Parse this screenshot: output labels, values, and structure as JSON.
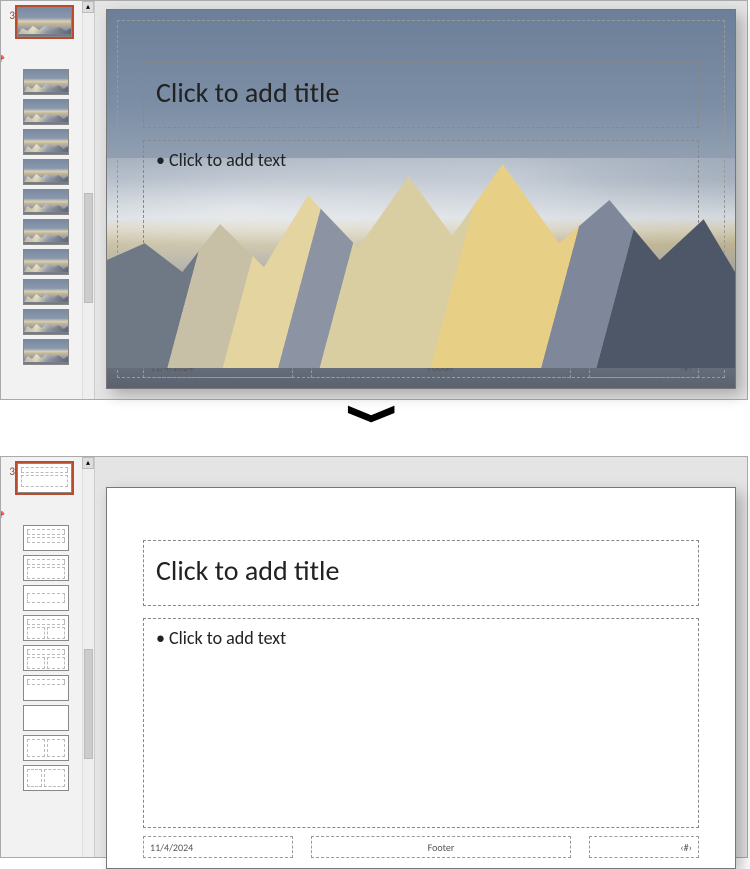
{
  "slideNumber": "3",
  "placeholders": {
    "title": "Click to add title",
    "body": "Click to add text"
  },
  "footer": {
    "date": "11/4/2024",
    "center": "Footer",
    "number": "‹#›"
  },
  "arrow_glyph": "❯",
  "scroll_up_glyph": "▴",
  "layoutNames": [
    "slide-master",
    "title-slide-layout",
    "title-content-layout",
    "section-header-layout",
    "two-content-layout",
    "comparison-layout",
    "title-only-layout",
    "blank-layout",
    "content-caption-layout",
    "picture-caption-layout"
  ]
}
